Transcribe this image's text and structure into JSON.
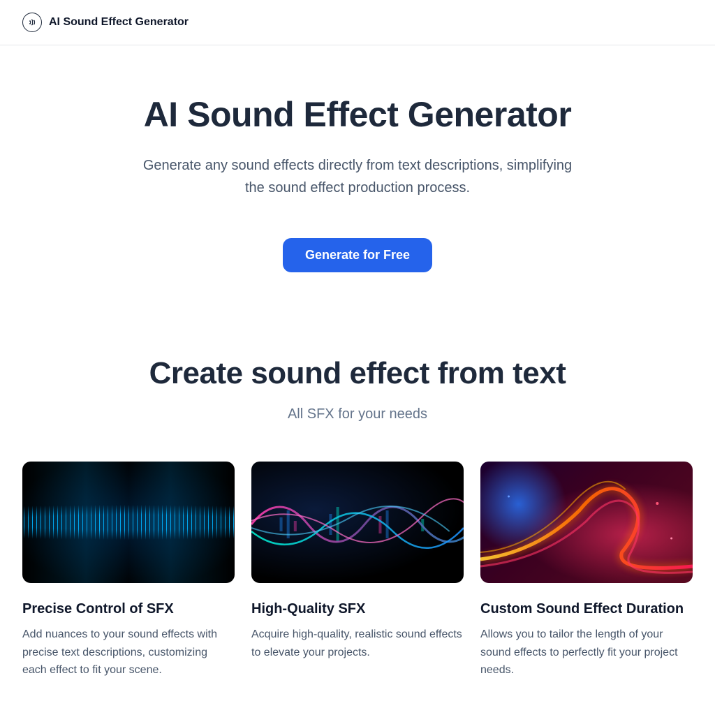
{
  "header": {
    "brand": "AI Sound Effect Generator"
  },
  "hero": {
    "title": "AI Sound Effect Generator",
    "subtitle": "Generate any sound effects directly from text descriptions, simplifying the sound effect production process.",
    "cta": "Generate for Free"
  },
  "features": {
    "title": "Create sound effect from text",
    "subtitle": "All SFX for your needs",
    "cards": [
      {
        "title": "Precise Control of SFX",
        "desc": "Add nuances to your sound effects with precise text descriptions, customizing each effect to fit your scene."
      },
      {
        "title": "High-Quality SFX",
        "desc": "Acquire high-quality, realistic sound effects to elevate your projects."
      },
      {
        "title": "Custom Sound Effect Duration",
        "desc": "Allows you to tailor the length of your sound effects to perfectly fit your project needs."
      }
    ]
  }
}
